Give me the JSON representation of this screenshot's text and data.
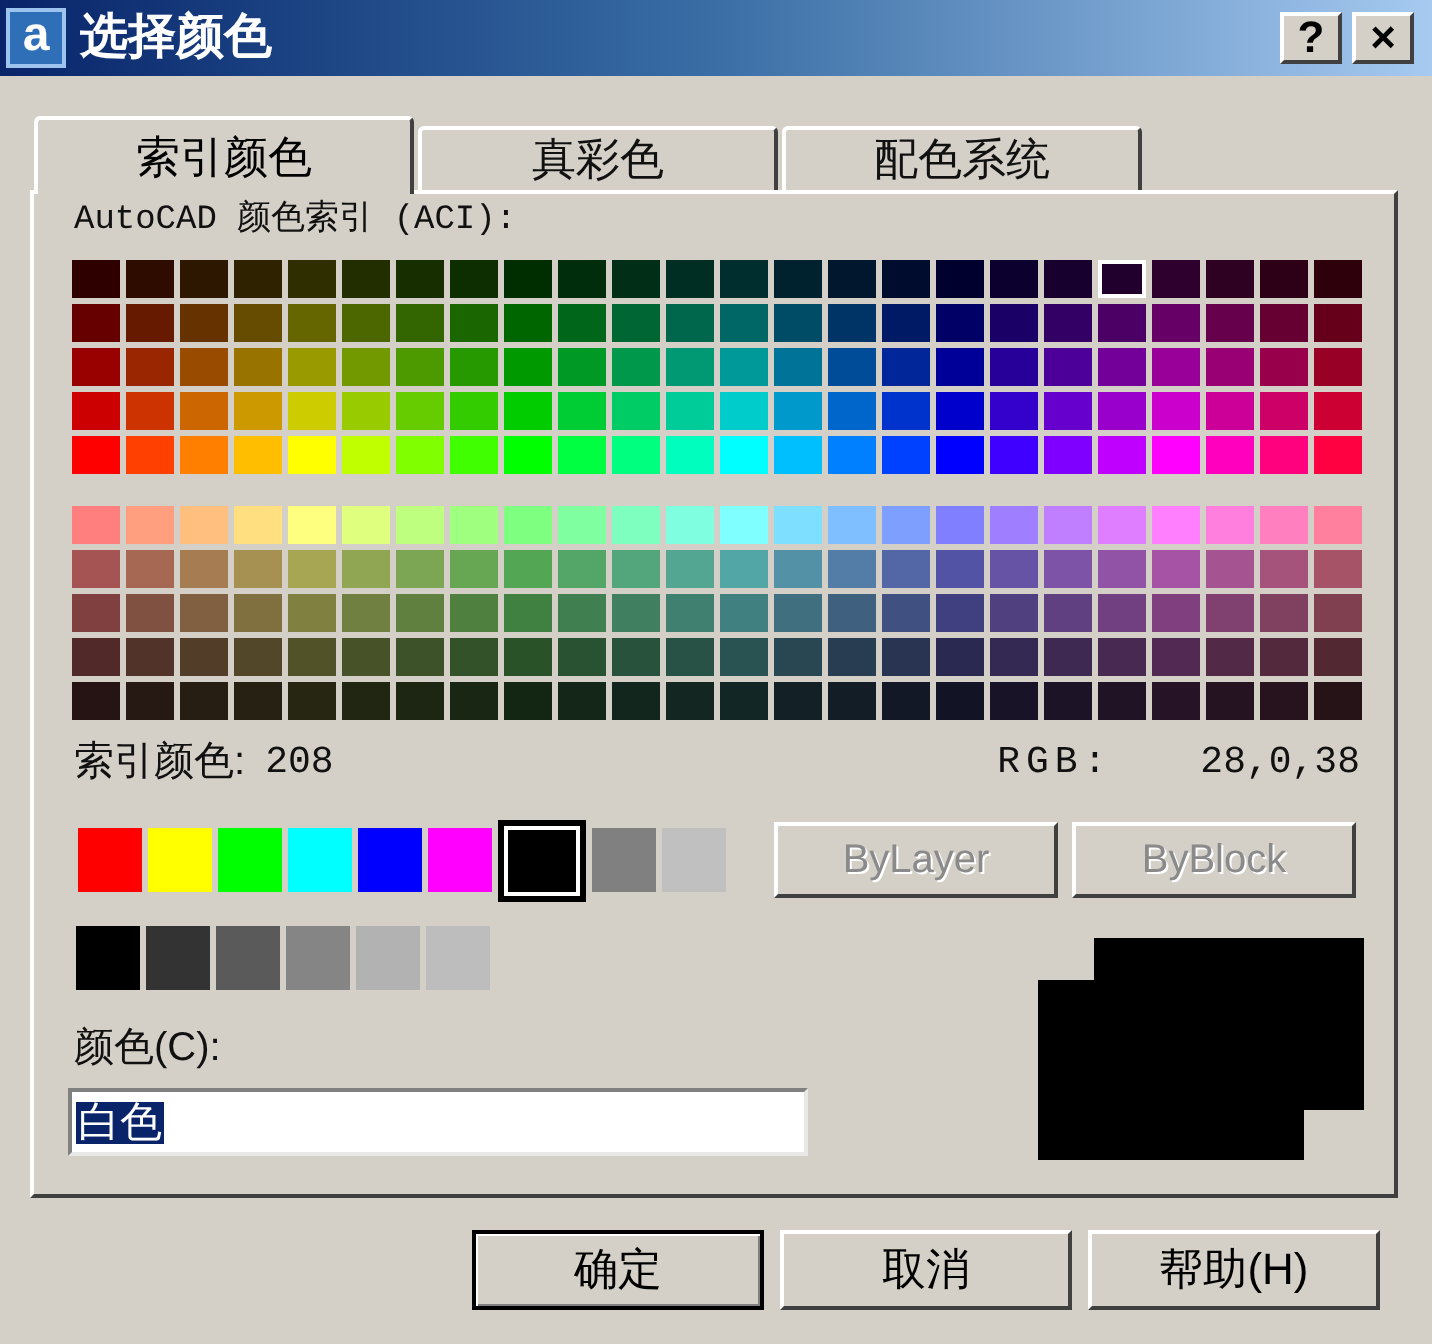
{
  "window": {
    "icon_letter": "a",
    "title": "选择颜色",
    "title_buttons": [
      "?",
      "×"
    ]
  },
  "tabs": [
    {
      "label": "索引颜色",
      "selected": true
    },
    {
      "label": "真彩色",
      "selected": false
    },
    {
      "label": "配色系统",
      "selected": false
    }
  ],
  "aci_palette": {
    "label": "AutoCAD 颜色索引 (ACI):",
    "upper_rows": [
      [
        {
          "color": "#2e0000",
          "selected": false
        },
        {
          "color": "#2e0c00",
          "selected": false
        },
        {
          "color": "#2e1700",
          "selected": false
        },
        {
          "color": "#2e2200",
          "selected": false
        },
        {
          "color": "#2e2e00",
          "selected": false
        },
        {
          "color": "#222e00",
          "selected": false
        },
        {
          "color": "#172e00",
          "selected": false
        },
        {
          "color": "#0c2e00",
          "selected": false
        },
        {
          "color": "#002e00",
          "selected": false
        },
        {
          "color": "#002e0c",
          "selected": false
        },
        {
          "color": "#002e17",
          "selected": false
        },
        {
          "color": "#002e22",
          "selected": false
        },
        {
          "color": "#002e2e",
          "selected": false
        },
        {
          "color": "#00222e",
          "selected": false
        },
        {
          "color": "#00172e",
          "selected": false
        },
        {
          "color": "#000c2e",
          "selected": false
        },
        {
          "color": "#00002e",
          "selected": false
        },
        {
          "color": "#0c002e",
          "selected": false
        },
        {
          "color": "#17002e",
          "selected": false
        },
        {
          "color": "#22002e",
          "selected": true
        },
        {
          "color": "#2e002e",
          "selected": false
        },
        {
          "color": "#2e0022",
          "selected": false
        },
        {
          "color": "#2e0017",
          "selected": false
        },
        {
          "color": "#2e000c",
          "selected": false
        }
      ],
      [
        {
          "color": "#660000",
          "selected": false
        },
        {
          "color": "#661a00",
          "selected": false
        },
        {
          "color": "#663300",
          "selected": false
        },
        {
          "color": "#664c00",
          "selected": false
        },
        {
          "color": "#666600",
          "selected": false
        },
        {
          "color": "#4c6600",
          "selected": false
        },
        {
          "color": "#336600",
          "selected": false
        },
        {
          "color": "#1a6600",
          "selected": false
        },
        {
          "color": "#006600",
          "selected": false
        },
        {
          "color": "#00661a",
          "selected": false
        },
        {
          "color": "#006633",
          "selected": false
        },
        {
          "color": "#00664c",
          "selected": false
        },
        {
          "color": "#006666",
          "selected": false
        },
        {
          "color": "#004c66",
          "selected": false
        },
        {
          "color": "#003366",
          "selected": false
        },
        {
          "color": "#001a66",
          "selected": false
        },
        {
          "color": "#000066",
          "selected": false
        },
        {
          "color": "#1a0066",
          "selected": false
        },
        {
          "color": "#330066",
          "selected": false
        },
        {
          "color": "#4c0066",
          "selected": false
        },
        {
          "color": "#660066",
          "selected": false
        },
        {
          "color": "#66004c",
          "selected": false
        },
        {
          "color": "#660033",
          "selected": false
        },
        {
          "color": "#66001a",
          "selected": false
        }
      ],
      [
        {
          "color": "#990000",
          "selected": false
        },
        {
          "color": "#992600",
          "selected": false
        },
        {
          "color": "#994c00",
          "selected": false
        },
        {
          "color": "#997300",
          "selected": false
        },
        {
          "color": "#999900",
          "selected": false
        },
        {
          "color": "#739900",
          "selected": false
        },
        {
          "color": "#4c9900",
          "selected": false
        },
        {
          "color": "#269900",
          "selected": false
        },
        {
          "color": "#009900",
          "selected": false
        },
        {
          "color": "#009926",
          "selected": false
        },
        {
          "color": "#00994c",
          "selected": false
        },
        {
          "color": "#009973",
          "selected": false
        },
        {
          "color": "#009999",
          "selected": false
        },
        {
          "color": "#007399",
          "selected": false
        },
        {
          "color": "#004c99",
          "selected": false
        },
        {
          "color": "#002699",
          "selected": false
        },
        {
          "color": "#000099",
          "selected": false
        },
        {
          "color": "#260099",
          "selected": false
        },
        {
          "color": "#4c0099",
          "selected": false
        },
        {
          "color": "#730099",
          "selected": false
        },
        {
          "color": "#990099",
          "selected": false
        },
        {
          "color": "#990073",
          "selected": false
        },
        {
          "color": "#99004c",
          "selected": false
        },
        {
          "color": "#990026",
          "selected": false
        }
      ],
      [
        {
          "color": "#cc0000",
          "selected": false
        },
        {
          "color": "#cc3300",
          "selected": false
        },
        {
          "color": "#cc6600",
          "selected": false
        },
        {
          "color": "#cc9900",
          "selected": false
        },
        {
          "color": "#cccc00",
          "selected": false
        },
        {
          "color": "#99cc00",
          "selected": false
        },
        {
          "color": "#66cc00",
          "selected": false
        },
        {
          "color": "#33cc00",
          "selected": false
        },
        {
          "color": "#00cc00",
          "selected": false
        },
        {
          "color": "#00cc33",
          "selected": false
        },
        {
          "color": "#00cc66",
          "selected": false
        },
        {
          "color": "#00cc99",
          "selected": false
        },
        {
          "color": "#00cccc",
          "selected": false
        },
        {
          "color": "#0099cc",
          "selected": false
        },
        {
          "color": "#0066cc",
          "selected": false
        },
        {
          "color": "#0033cc",
          "selected": false
        },
        {
          "color": "#0000cc",
          "selected": false
        },
        {
          "color": "#3300cc",
          "selected": false
        },
        {
          "color": "#6600cc",
          "selected": false
        },
        {
          "color": "#9900cc",
          "selected": false
        },
        {
          "color": "#cc00cc",
          "selected": false
        },
        {
          "color": "#cc0099",
          "selected": false
        },
        {
          "color": "#cc0066",
          "selected": false
        },
        {
          "color": "#cc0033",
          "selected": false
        }
      ],
      [
        {
          "color": "#ff0000",
          "selected": false
        },
        {
          "color": "#ff4000",
          "selected": false
        },
        {
          "color": "#ff7f00",
          "selected": false
        },
        {
          "color": "#ffbf00",
          "selected": false
        },
        {
          "color": "#ffff00",
          "selected": false
        },
        {
          "color": "#bfff00",
          "selected": false
        },
        {
          "color": "#7fff00",
          "selected": false
        },
        {
          "color": "#40ff00",
          "selected": false
        },
        {
          "color": "#00ff00",
          "selected": false
        },
        {
          "color": "#00ff40",
          "selected": false
        },
        {
          "color": "#00ff7f",
          "selected": false
        },
        {
          "color": "#00ffbf",
          "selected": false
        },
        {
          "color": "#00ffff",
          "selected": false
        },
        {
          "color": "#00bfff",
          "selected": false
        },
        {
          "color": "#007fff",
          "selected": false
        },
        {
          "color": "#0040ff",
          "selected": false
        },
        {
          "color": "#0000ff",
          "selected": false
        },
        {
          "color": "#4000ff",
          "selected": false
        },
        {
          "color": "#7f00ff",
          "selected": false
        },
        {
          "color": "#bf00ff",
          "selected": false
        },
        {
          "color": "#ff00ff",
          "selected": false
        },
        {
          "color": "#ff00bf",
          "selected": false
        },
        {
          "color": "#ff007f",
          "selected": false
        },
        {
          "color": "#ff0040",
          "selected": false
        }
      ]
    ],
    "lower_rows": [
      [
        {
          "color": "#ff7f7f",
          "selected": false
        },
        {
          "color": "#ff9f7f",
          "selected": false
        },
        {
          "color": "#ffbf7f",
          "selected": false
        },
        {
          "color": "#ffdf7f",
          "selected": false
        },
        {
          "color": "#ffff7f",
          "selected": false
        },
        {
          "color": "#dfff7f",
          "selected": false
        },
        {
          "color": "#bfff7f",
          "selected": false
        },
        {
          "color": "#9fff7f",
          "selected": false
        },
        {
          "color": "#7fff7f",
          "selected": false
        },
        {
          "color": "#7fff9f",
          "selected": false
        },
        {
          "color": "#7fffbf",
          "selected": false
        },
        {
          "color": "#7fffdf",
          "selected": false
        },
        {
          "color": "#7fffff",
          "selected": false
        },
        {
          "color": "#7fdfff",
          "selected": false
        },
        {
          "color": "#7fbfff",
          "selected": false
        },
        {
          "color": "#7f9fff",
          "selected": false
        },
        {
          "color": "#7f7fff",
          "selected": false
        },
        {
          "color": "#9f7fff",
          "selected": false
        },
        {
          "color": "#bf7fff",
          "selected": false
        },
        {
          "color": "#df7fff",
          "selected": false
        },
        {
          "color": "#ff7fff",
          "selected": false
        },
        {
          "color": "#ff7fdf",
          "selected": false
        },
        {
          "color": "#ff7fbf",
          "selected": false
        },
        {
          "color": "#ff7f9f",
          "selected": false
        }
      ],
      [
        {
          "color": "#a65353",
          "selected": false
        },
        {
          "color": "#a66753",
          "selected": false
        },
        {
          "color": "#a67c53",
          "selected": false
        },
        {
          "color": "#a69153",
          "selected": false
        },
        {
          "color": "#a6a653",
          "selected": false
        },
        {
          "color": "#91a653",
          "selected": false
        },
        {
          "color": "#7ca653",
          "selected": false
        },
        {
          "color": "#67a653",
          "selected": false
        },
        {
          "color": "#53a653",
          "selected": false
        },
        {
          "color": "#53a667",
          "selected": false
        },
        {
          "color": "#53a67c",
          "selected": false
        },
        {
          "color": "#53a691",
          "selected": false
        },
        {
          "color": "#53a6a6",
          "selected": false
        },
        {
          "color": "#5391a6",
          "selected": false
        },
        {
          "color": "#537ca6",
          "selected": false
        },
        {
          "color": "#5367a6",
          "selected": false
        },
        {
          "color": "#5353a6",
          "selected": false
        },
        {
          "color": "#6753a6",
          "selected": false
        },
        {
          "color": "#7c53a6",
          "selected": false
        },
        {
          "color": "#9153a6",
          "selected": false
        },
        {
          "color": "#a653a6",
          "selected": false
        },
        {
          "color": "#a65391",
          "selected": false
        },
        {
          "color": "#a6537c",
          "selected": false
        },
        {
          "color": "#a65367",
          "selected": false
        }
      ],
      [
        {
          "color": "#804040",
          "selected": false
        },
        {
          "color": "#805040",
          "selected": false
        },
        {
          "color": "#806040",
          "selected": false
        },
        {
          "color": "#807040",
          "selected": false
        },
        {
          "color": "#808040",
          "selected": false
        },
        {
          "color": "#708040",
          "selected": false
        },
        {
          "color": "#608040",
          "selected": false
        },
        {
          "color": "#508040",
          "selected": false
        },
        {
          "color": "#408040",
          "selected": false
        },
        {
          "color": "#408050",
          "selected": false
        },
        {
          "color": "#408060",
          "selected": false
        },
        {
          "color": "#408070",
          "selected": false
        },
        {
          "color": "#408080",
          "selected": false
        },
        {
          "color": "#407080",
          "selected": false
        },
        {
          "color": "#406080",
          "selected": false
        },
        {
          "color": "#405080",
          "selected": false
        },
        {
          "color": "#404080",
          "selected": false
        },
        {
          "color": "#504080",
          "selected": false
        },
        {
          "color": "#604080",
          "selected": false
        },
        {
          "color": "#704080",
          "selected": false
        },
        {
          "color": "#804080",
          "selected": false
        },
        {
          "color": "#804070",
          "selected": false
        },
        {
          "color": "#804060",
          "selected": false
        },
        {
          "color": "#804050",
          "selected": false
        }
      ],
      [
        {
          "color": "#522929",
          "selected": false
        },
        {
          "color": "#523329",
          "selected": false
        },
        {
          "color": "#523d29",
          "selected": false
        },
        {
          "color": "#524729",
          "selected": false
        },
        {
          "color": "#525229",
          "selected": false
        },
        {
          "color": "#475229",
          "selected": false
        },
        {
          "color": "#3d5229",
          "selected": false
        },
        {
          "color": "#335229",
          "selected": false
        },
        {
          "color": "#295229",
          "selected": false
        },
        {
          "color": "#295233",
          "selected": false
        },
        {
          "color": "#29523d",
          "selected": false
        },
        {
          "color": "#295247",
          "selected": false
        },
        {
          "color": "#295252",
          "selected": false
        },
        {
          "color": "#294752",
          "selected": false
        },
        {
          "color": "#293d52",
          "selected": false
        },
        {
          "color": "#293352",
          "selected": false
        },
        {
          "color": "#292952",
          "selected": false
        },
        {
          "color": "#332952",
          "selected": false
        },
        {
          "color": "#3d2952",
          "selected": false
        },
        {
          "color": "#472952",
          "selected": false
        },
        {
          "color": "#522952",
          "selected": false
        },
        {
          "color": "#522947",
          "selected": false
        },
        {
          "color": "#52293d",
          "selected": false
        },
        {
          "color": "#522933",
          "selected": false
        }
      ],
      [
        {
          "color": "#261313",
          "selected": false
        },
        {
          "color": "#261813",
          "selected": false
        },
        {
          "color": "#261d13",
          "selected": false
        },
        {
          "color": "#262113",
          "selected": false
        },
        {
          "color": "#262613",
          "selected": false
        },
        {
          "color": "#212613",
          "selected": false
        },
        {
          "color": "#1d2613",
          "selected": false
        },
        {
          "color": "#182613",
          "selected": false
        },
        {
          "color": "#132613",
          "selected": false
        },
        {
          "color": "#132618",
          "selected": false
        },
        {
          "color": "#13261d",
          "selected": false
        },
        {
          "color": "#132621",
          "selected": false
        },
        {
          "color": "#132626",
          "selected": false
        },
        {
          "color": "#132126",
          "selected": false
        },
        {
          "color": "#131d26",
          "selected": false
        },
        {
          "color": "#131826",
          "selected": false
        },
        {
          "color": "#131326",
          "selected": false
        },
        {
          "color": "#181326",
          "selected": false
        },
        {
          "color": "#1d1326",
          "selected": false
        },
        {
          "color": "#211326",
          "selected": false
        },
        {
          "color": "#261326",
          "selected": false
        },
        {
          "color": "#261321",
          "selected": false
        },
        {
          "color": "#26131d",
          "selected": false
        },
        {
          "color": "#261318",
          "selected": false
        }
      ]
    ]
  },
  "index_readout": {
    "label": "索引颜色:",
    "value": "208"
  },
  "rgb_readout": {
    "label": "RGB:",
    "value": "28,0,38"
  },
  "standard_colors": [
    {
      "color": "#ff0000",
      "selected": false
    },
    {
      "color": "#ffff00",
      "selected": false
    },
    {
      "color": "#00ff00",
      "selected": false
    },
    {
      "color": "#00ffff",
      "selected": false
    },
    {
      "color": "#0000ff",
      "selected": false
    },
    {
      "color": "#ff00ff",
      "selected": false
    },
    {
      "color": "#000000",
      "selected": true
    },
    {
      "color": "#808080",
      "selected": false
    },
    {
      "color": "#c0c0c0",
      "selected": false
    }
  ],
  "gray_colors": [
    {
      "color": "#000000",
      "selected": false
    },
    {
      "color": "#333333",
      "selected": false
    },
    {
      "color": "#5a5a5a",
      "selected": false
    },
    {
      "color": "#858585",
      "selected": false
    },
    {
      "color": "#b2b2b2",
      "selected": false
    },
    {
      "color": "#bdbdbd",
      "selected": false
    }
  ],
  "by_buttons": [
    {
      "label": "ByLayer",
      "disabled": true
    },
    {
      "label": "ByBlock",
      "disabled": true
    }
  ],
  "color_field": {
    "label": "颜色(C):",
    "value": "白色",
    "value_selected": true
  },
  "preview": [
    {
      "color": "#000000"
    },
    {
      "color": "#000000"
    }
  ],
  "buttons": [
    {
      "label": "确定",
      "default": true
    },
    {
      "label": "取消",
      "default": false
    },
    {
      "label": "帮助(H)",
      "default": false
    }
  ]
}
